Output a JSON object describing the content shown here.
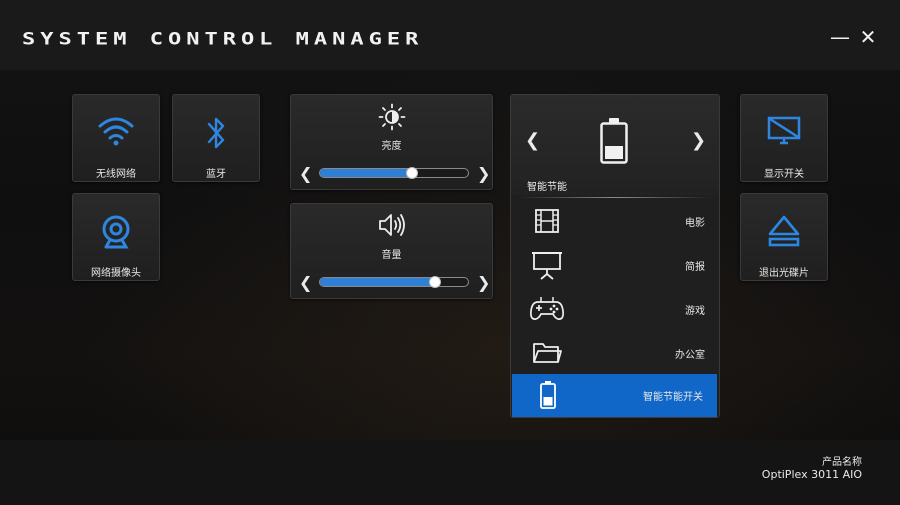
{
  "app": {
    "title": "SYSTEM CONTROL MANAGER",
    "minimize": "—",
    "close": "✕"
  },
  "colors": {
    "accent": "#1167c8",
    "icon_blue": "#2f86e0",
    "tile_bg": "#262627"
  },
  "tiles": {
    "wifi": {
      "label": "无线网络",
      "icon": "wifi-icon"
    },
    "bluetooth": {
      "label": "蓝牙",
      "icon": "bluetooth-icon"
    },
    "webcam": {
      "label": "网络摄像头",
      "icon": "webcam-icon"
    },
    "display": {
      "label": "显示开关",
      "icon": "display-off-icon"
    },
    "eject": {
      "label": "退出光碟片",
      "icon": "eject-icon"
    }
  },
  "brightness": {
    "label": "亮度",
    "icon": "sun-icon",
    "level": 0.62,
    "prev": "❮",
    "next": "❯"
  },
  "volume": {
    "label": "音量",
    "icon": "speaker-icon",
    "level": 0.78,
    "prev": "❮",
    "next": "❯"
  },
  "power": {
    "prev": "❮",
    "next": "❯",
    "current_mode": "智能节能",
    "battery_level": 0.4,
    "modes": [
      {
        "label": "电影",
        "icon": "film-icon"
      },
      {
        "label": "简报",
        "icon": "presentation-icon"
      },
      {
        "label": "游戏",
        "icon": "gamepad-icon"
      },
      {
        "label": "办公室",
        "icon": "folder-icon"
      },
      {
        "label": "智能节能开关",
        "icon": "battery-icon",
        "active": true
      }
    ]
  },
  "product": {
    "label": "产品名称",
    "name": "OptiPlex 3011 AIO"
  }
}
